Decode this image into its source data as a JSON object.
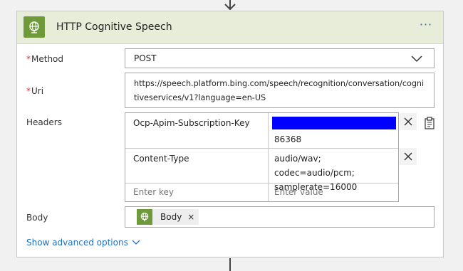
{
  "card": {
    "title": "HTTP Cognitive Speech",
    "more_label": "···"
  },
  "fields": {
    "method": {
      "label": "Method",
      "required": "*",
      "value": "POST"
    },
    "uri": {
      "label": "Uri",
      "required": "*",
      "value": "https://speech.platform.bing.com/speech/recognition/conversation/cognitiveservices/v1?language=en-US"
    },
    "headers": {
      "label": "Headers",
      "rows": [
        {
          "key": "Ocp-Apim-Subscription-Key",
          "value": "86368"
        },
        {
          "key": "Content-Type",
          "value": "audio/wav; codec=audio/pcm; samplerate=16000"
        }
      ],
      "key_placeholder": "Enter key",
      "value_placeholder": "Enter value"
    },
    "body": {
      "label": "Body",
      "token_label": "Body"
    }
  },
  "advanced_link": "Show advanced options",
  "colors": {
    "accent": "#6e9a3a",
    "header_bg": "#e8edd9",
    "link": "#1f6fc5",
    "redaction": "#0000ff",
    "required": "#d13438"
  },
  "icons": {
    "app": "globe-icon",
    "method_dropdown": "chevron-down-icon",
    "row_remove": "close-icon",
    "header_mode": "clipboard-icon",
    "advanced": "chevron-down-icon"
  }
}
